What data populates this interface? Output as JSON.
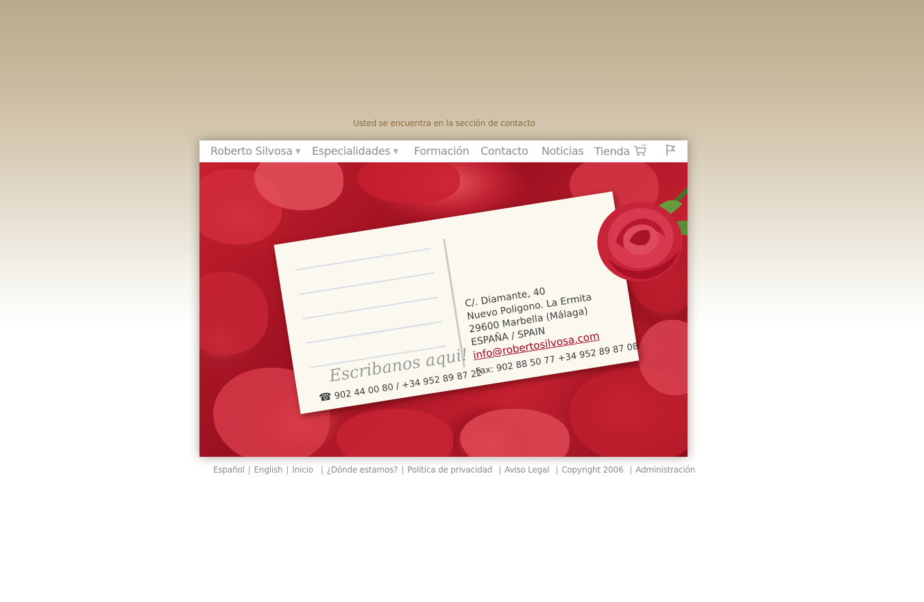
{
  "breadcrumb": "Usted se encuentra en la sección de contacto",
  "nav": {
    "items": [
      {
        "label": "Roberto Silvosa",
        "has_dropdown": true
      },
      {
        "label": "Especialidades",
        "has_dropdown": true
      },
      {
        "label": "Formación"
      },
      {
        "label": "Contacto"
      },
      {
        "label": "Noticias"
      },
      {
        "label": "Tienda",
        "icon": "cart-icon"
      }
    ],
    "flag_icon": "flag-icon"
  },
  "postcard": {
    "heading": "Escribanos aqui!",
    "address": {
      "line1": "C/. Diamante, 40",
      "line2": "Nuevo Poligono. La Ermita",
      "line3": "29600 Marbella (Málaga)",
      "line4": "ESPAÑA / SPAIN"
    },
    "email": "info@robertosilvosa.com",
    "phone": "902 44 00 80 / +34 952 89 87 22",
    "phone_icon": "telephone-icon",
    "fax": "Fax: 902 88 50 77  +34 952 89 87 08"
  },
  "footer": {
    "links": [
      "Español",
      "English",
      "Inicio",
      "¿Dónde estamos?",
      "Política de privacidad",
      "Aviso Legal",
      "Copyright 2006",
      "Administración"
    ]
  },
  "colors": {
    "accent_email": "#a0001c",
    "nav_text": "#8c8c8c",
    "breadcrumb_text": "#8a6a3a"
  }
}
